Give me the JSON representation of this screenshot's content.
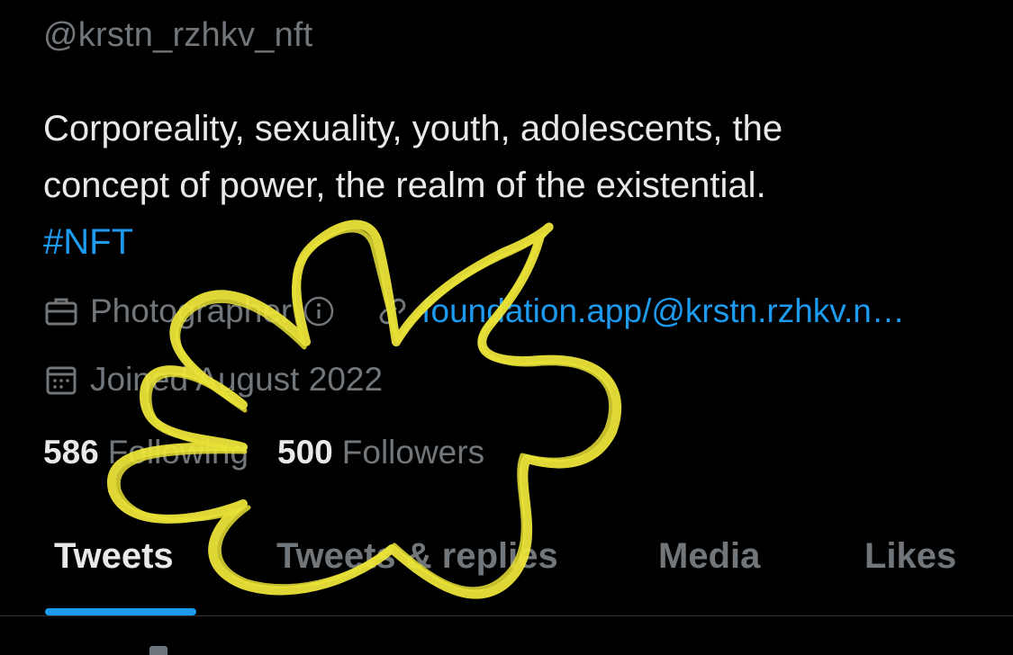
{
  "profile": {
    "handle": "@krstn_rzhkv_nft",
    "bio_lines": [
      "Corporeality, sexuality, youth, adolescents, the",
      "concept of power, the realm of the existential."
    ],
    "bio_hashtag": "#NFT",
    "category": "Photographer",
    "website": "foundation.app/@krstn.rzhkv.n…",
    "joined": "Joined August 2022",
    "following_count": "586",
    "following_label": "Following",
    "followers_count": "500",
    "followers_label": "Followers"
  },
  "tabs": [
    {
      "label": "Tweets",
      "active": true
    },
    {
      "label": "Tweets & replies",
      "active": false
    },
    {
      "label": "Media",
      "active": false
    },
    {
      "label": "Likes",
      "active": false
    }
  ],
  "icons": {
    "category": "briefcase-icon",
    "info": "info-icon",
    "website": "link-icon",
    "joined": "calendar-icon"
  },
  "colors": {
    "background": "#000000",
    "text_primary": "#e7e9ea",
    "text_secondary": "#71767b",
    "accent": "#1d9bf0",
    "scribble": "#f2e93a"
  }
}
